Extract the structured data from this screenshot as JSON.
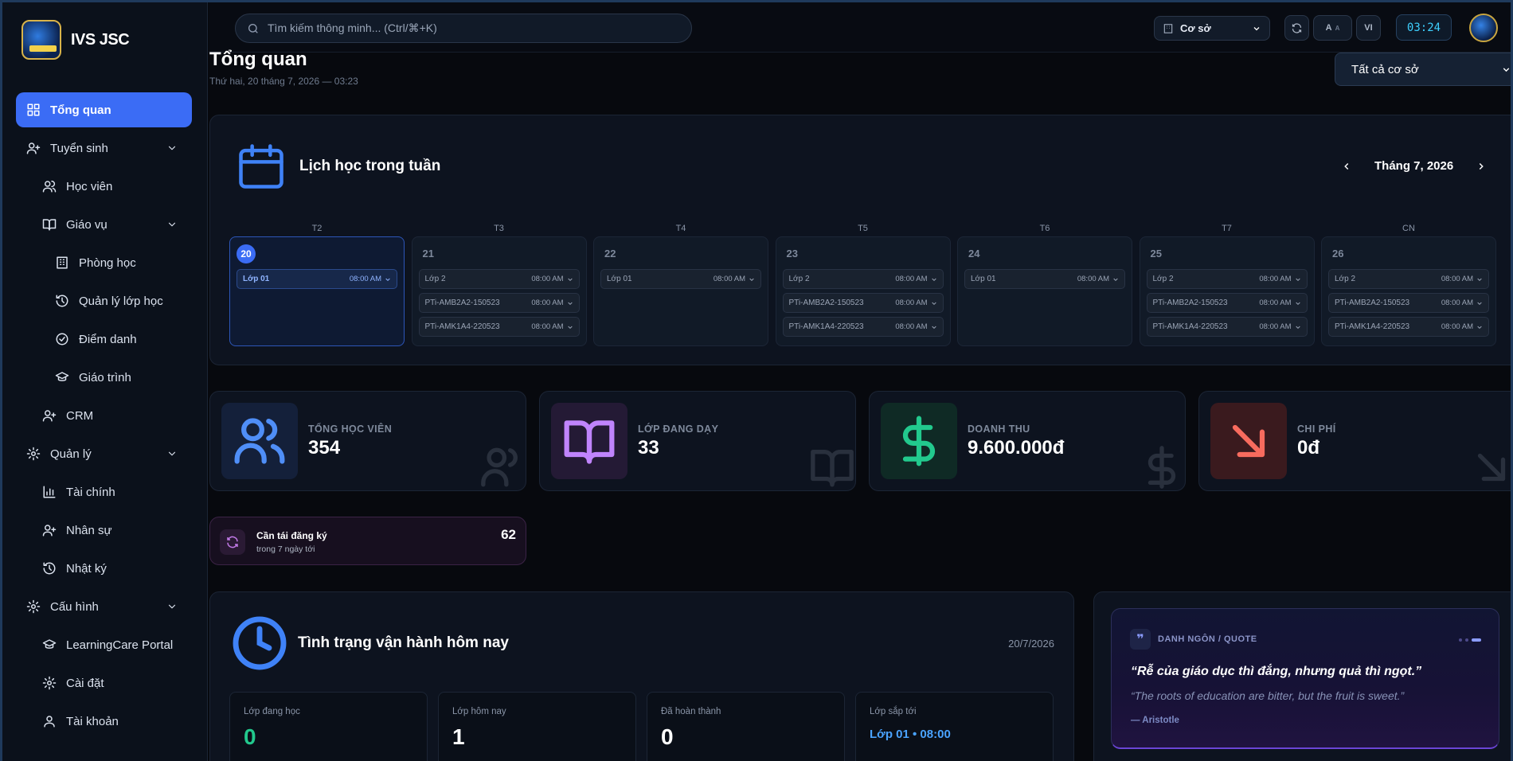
{
  "brand": {
    "name": "IVS JSC"
  },
  "sidebar": {
    "items": [
      {
        "label": "Tổng quan"
      },
      {
        "label": "Tuyển sinh"
      },
      {
        "label": "Học viên"
      },
      {
        "label": "Giáo vụ"
      },
      {
        "label": "Phòng học"
      },
      {
        "label": "Quản lý lớp học"
      },
      {
        "label": "Điểm danh"
      },
      {
        "label": "Giáo trình"
      },
      {
        "label": "CRM"
      },
      {
        "label": "Quản lý"
      },
      {
        "label": "Tài chính"
      },
      {
        "label": "Nhân sự"
      },
      {
        "label": "Nhật ký"
      },
      {
        "label": "Cấu hình"
      },
      {
        "label": "LearningCare Portal"
      },
      {
        "label": "Cài đặt"
      },
      {
        "label": "Tài khoản"
      }
    ]
  },
  "topbar": {
    "search_placeholder": "Tìm kiếm thông minh... (Ctrl/⌘+K)",
    "branch": "Cơ sở",
    "font_btn": "A",
    "font_btn_small": "A",
    "lang": "VI",
    "clock": "03:24"
  },
  "page": {
    "title": "Tổng quan",
    "date": "Thứ hai, 20 tháng 7, 2026 — 03:23",
    "branch_filter": "Tất cả cơ sở"
  },
  "schedule": {
    "title": "Lịch học trong tuần",
    "month": "Tháng 7, 2026",
    "days": [
      {
        "label": "T2",
        "num": "20",
        "today": true,
        "classes": [
          {
            "name": "Lớp 01",
            "time": "08:00 AM"
          }
        ]
      },
      {
        "label": "T3",
        "num": "21",
        "classes": [
          {
            "name": "Lớp 2",
            "time": "08:00 AM"
          },
          {
            "name": "PTi-AMB2A2-150523",
            "time": "08:00 AM"
          },
          {
            "name": "PTi-AMK1A4-220523",
            "time": "08:00 AM"
          }
        ]
      },
      {
        "label": "T4",
        "num": "22",
        "classes": [
          {
            "name": "Lớp 01",
            "time": "08:00 AM"
          }
        ]
      },
      {
        "label": "T5",
        "num": "23",
        "classes": [
          {
            "name": "Lớp 2",
            "time": "08:00 AM"
          },
          {
            "name": "PTi-AMB2A2-150523",
            "time": "08:00 AM"
          },
          {
            "name": "PTi-AMK1A4-220523",
            "time": "08:00 AM"
          }
        ]
      },
      {
        "label": "T6",
        "num": "24",
        "classes": [
          {
            "name": "Lớp 01",
            "time": "08:00 AM"
          }
        ]
      },
      {
        "label": "T7",
        "num": "25",
        "classes": [
          {
            "name": "Lớp 2",
            "time": "08:00 AM"
          },
          {
            "name": "PTi-AMB2A2-150523",
            "time": "08:00 AM"
          },
          {
            "name": "PTi-AMK1A4-220523",
            "time": "08:00 AM"
          }
        ]
      },
      {
        "label": "CN",
        "num": "26",
        "classes": [
          {
            "name": "Lớp 2",
            "time": "08:00 AM"
          },
          {
            "name": "PTi-AMB2A2-150523",
            "time": "08:00 AM"
          },
          {
            "name": "PTi-AMK1A4-220523",
            "time": "08:00 AM"
          }
        ]
      }
    ]
  },
  "stats": [
    {
      "label": "TỔNG HỌC VIÊN",
      "value": "354",
      "icon": "users-icon",
      "color": "#4f8ef7"
    },
    {
      "label": "LỚP ĐANG DẠY",
      "value": "33",
      "icon": "book-icon",
      "color": "#c084fc"
    },
    {
      "label": "DOANH THU",
      "value": "9.600.000đ",
      "icon": "dollar-icon",
      "color": "#22c98d"
    },
    {
      "label": "CHI PHÍ",
      "value": "0đ",
      "icon": "arrow-down-right-icon",
      "color": "#f76b5e"
    }
  ],
  "renew": {
    "title": "Cần tái đăng ký",
    "subtitle": "trong 7 ngày tới",
    "count": "62"
  },
  "operations": {
    "title": "Tình trạng vận hành hôm nay",
    "date": "20/7/2026",
    "boxes": [
      {
        "label": "Lớp đang học",
        "value": "0"
      },
      {
        "label": "Lớp hôm nay",
        "value": "1"
      },
      {
        "label": "Đã hoàn thành",
        "value": "0"
      },
      {
        "label": "Lớp sắp tới",
        "value": "Lớp 01 • 08:00"
      }
    ]
  },
  "quote": {
    "label": "DANH NGÔN / QUOTE",
    "vi": "“Rễ của giáo dục thì đắng, nhưng quả thì ngọt.”",
    "en": "“The roots of education are bitter, but the fruit is sweet.”",
    "author": "— Aristotle"
  }
}
